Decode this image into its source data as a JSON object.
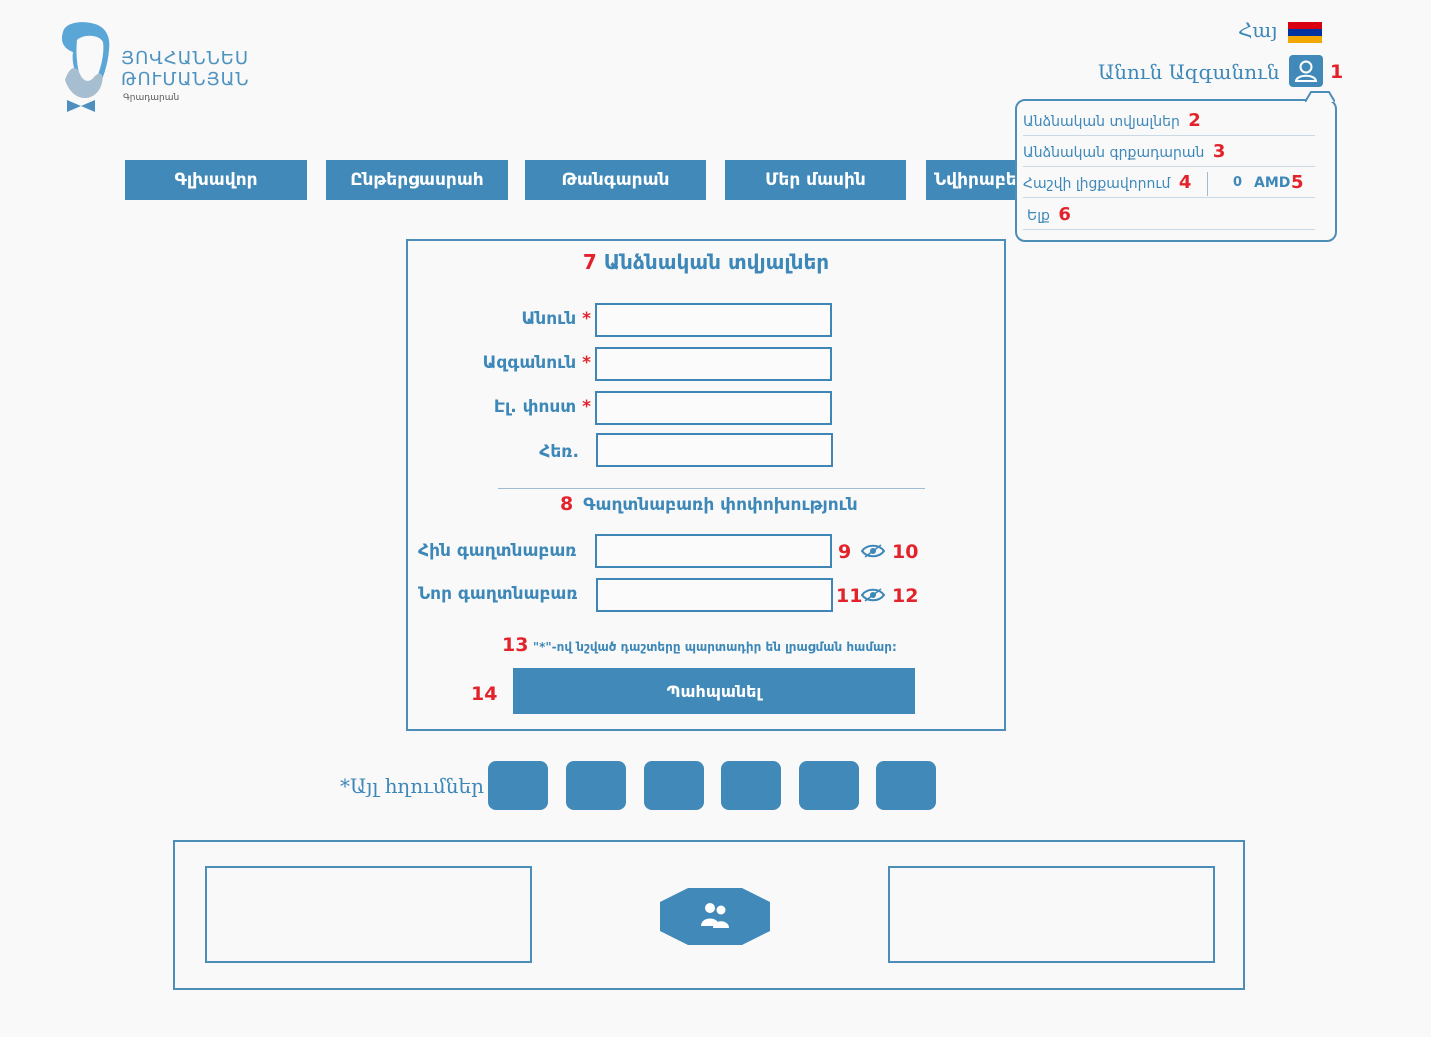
{
  "logo": {
    "line1": "ՅՈՎՀԱՆՆԵՍ",
    "line2": "ԹՈՒՄԱՆՅԱՆ",
    "sub": "Գրադարան"
  },
  "header": {
    "language": "Հայ",
    "user_name": "Անուն Ազգանուն",
    "num_user": "1"
  },
  "nav": {
    "items": [
      "Գլխավոր",
      "Ընթերցասրահ",
      "Թանգարան",
      "Մեր մասին",
      "Նվիրաբերություն"
    ]
  },
  "dropdown": {
    "items": [
      {
        "label": "Անձնական տվյալներ",
        "num": "2"
      },
      {
        "label": "Անձնական գրքադարան",
        "num": "3"
      },
      {
        "label": "Հաշվի լիցքավորում",
        "num": "4"
      },
      {
        "label": "Ելք",
        "num": "6"
      }
    ],
    "balance_value": "0",
    "balance_currency": "AMD",
    "balance_num": "5"
  },
  "form": {
    "title_num": "7",
    "title": "Անձնական տվյալներ",
    "fields": [
      {
        "label": "Անուն",
        "required": "*",
        "value": ""
      },
      {
        "label": "Ազգանուն",
        "required": "*",
        "value": ""
      },
      {
        "label": "Էլ. փոստ",
        "required": "*",
        "value": ""
      },
      {
        "label": "Հեռ.",
        "value": ""
      }
    ],
    "password_section_num": "8",
    "password_section_title": "Գաղտնաբառի փոփոխություն",
    "old_password": {
      "label": "Հին գաղտնաբառ",
      "num_field": "9",
      "num_eye": "10",
      "value": ""
    },
    "new_password": {
      "label": "Նոր գաղտնաբառ",
      "num_field": "11",
      "num_eye": "12",
      "value": ""
    },
    "note_num": "13",
    "note": "\"*\"-ով նշված դաշտերը պարտադիր են լրացման համար:",
    "save_num": "14",
    "save_label": "Պահպանել"
  },
  "other_logins": {
    "label": "*Այլ հղումներ",
    "count": 6
  },
  "colors": {
    "primary": "#4089b8",
    "accent_red": "#e3232b",
    "background": "#f9f9f9"
  }
}
